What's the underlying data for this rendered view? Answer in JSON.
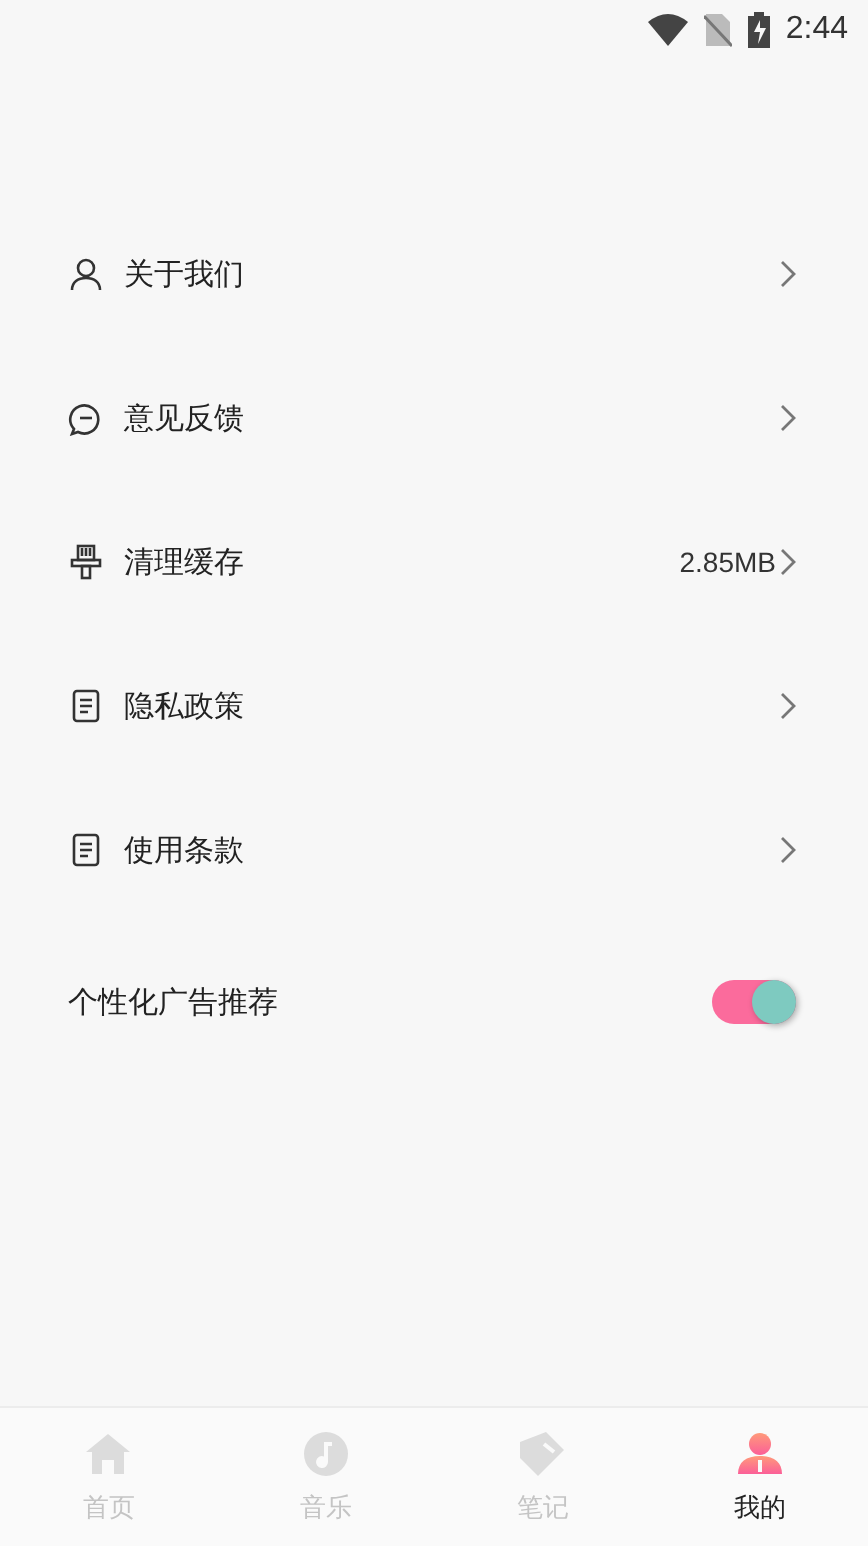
{
  "status_bar": {
    "time": "2:44"
  },
  "menu": [
    {
      "kind": "person",
      "label": "关于我们"
    },
    {
      "kind": "chat",
      "label": "意见反馈"
    },
    {
      "kind": "brush",
      "label": "清理缓存",
      "value": "2.85MB"
    },
    {
      "kind": "document",
      "label": "隐私政策"
    },
    {
      "kind": "document",
      "label": "使用条款"
    }
  ],
  "ad_toggle": {
    "label": "个性化广告推荐",
    "on": true
  },
  "tab_bar": [
    {
      "kind": "home",
      "label": "首页",
      "selected": false
    },
    {
      "kind": "music",
      "label": "音乐",
      "selected": false
    },
    {
      "kind": "note",
      "label": "笔记",
      "selected": false
    },
    {
      "kind": "me",
      "label": "我的",
      "selected": true
    }
  ]
}
